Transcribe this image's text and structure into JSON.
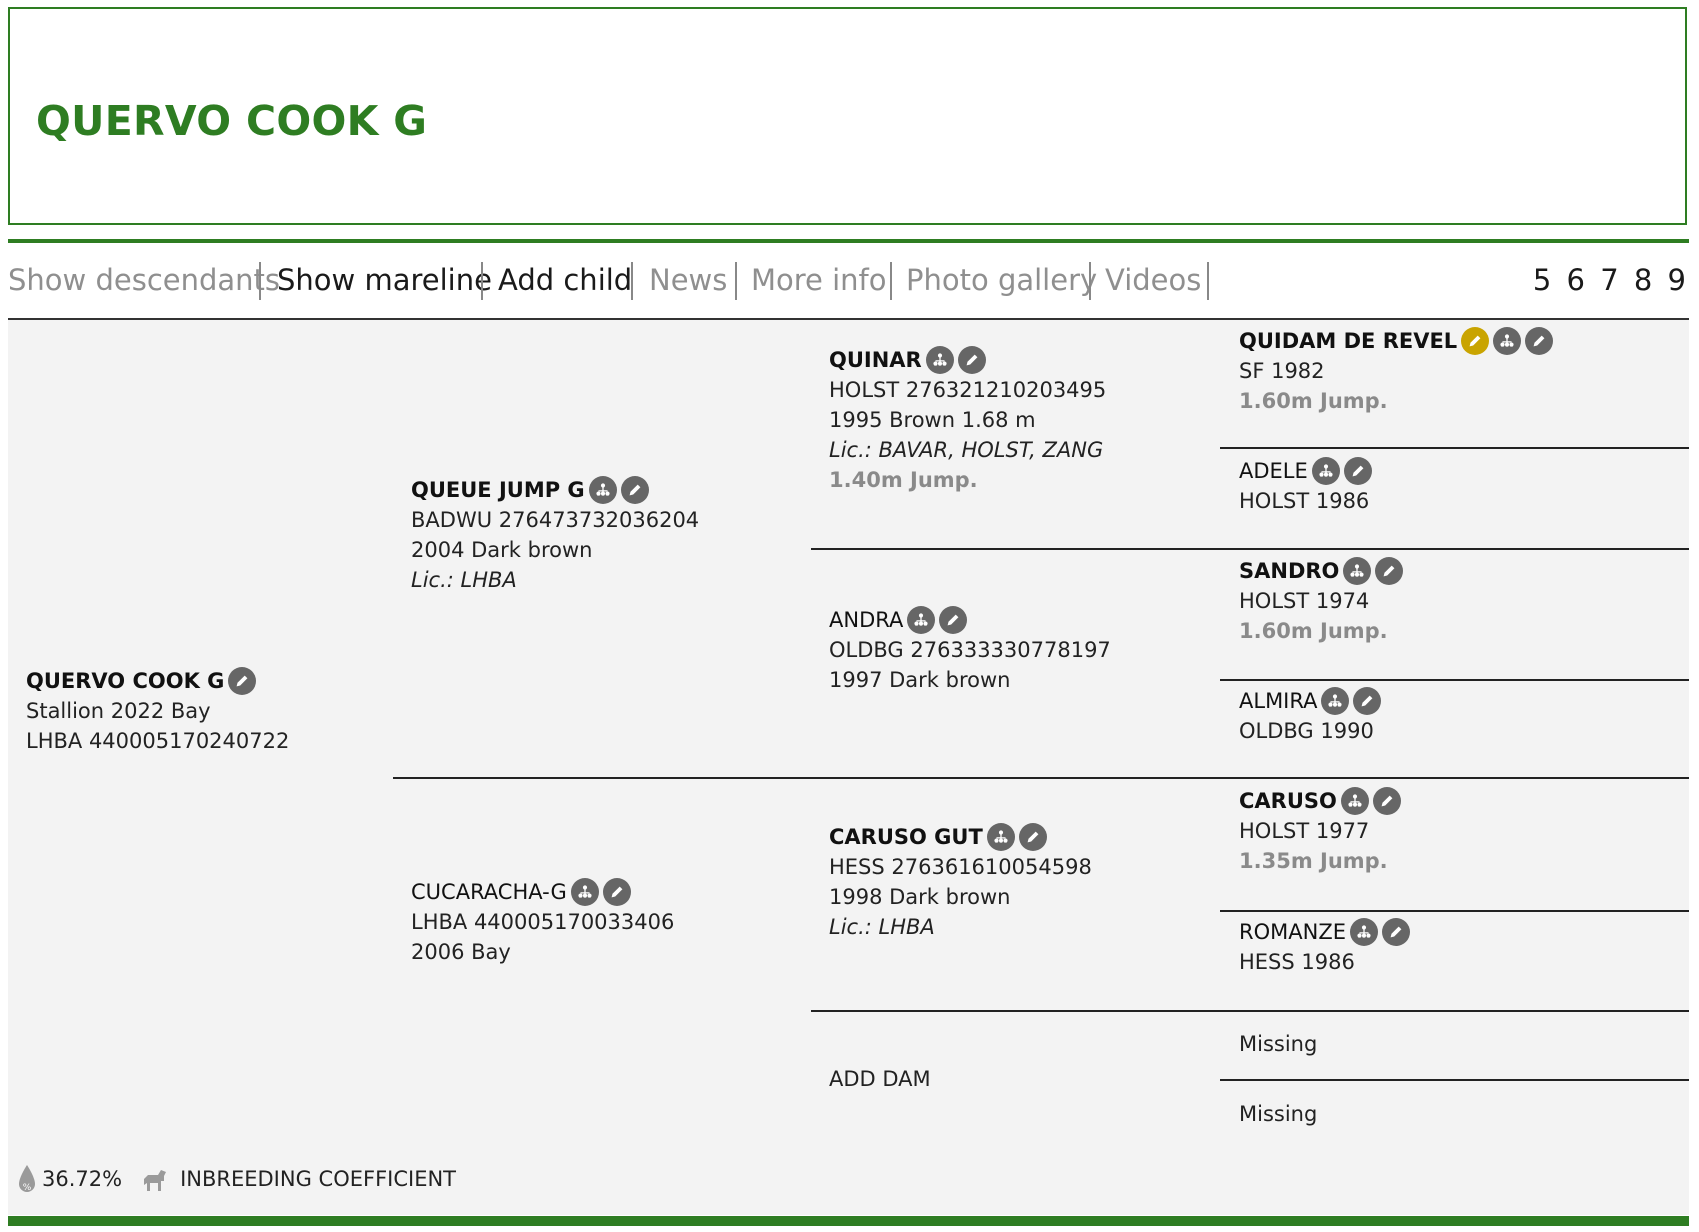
{
  "title": "QUERVO COOK G",
  "toolbar": {
    "items": [
      "Show descendants",
      "Show mareline",
      "Add child",
      "News",
      "More info",
      "Photo gallery",
      "Videos"
    ],
    "generations": "5 6 7 8 9"
  },
  "subject": {
    "name": "QUERVO COOK G",
    "line1": "Stallion 2022 Bay",
    "line2": "LHBA 440005170240722"
  },
  "sire": {
    "name": "QUEUE JUMP G",
    "line1": "BADWU 276473732036204",
    "line2": "2004 Dark brown",
    "lic": "Lic.: LHBA"
  },
  "dam": {
    "name": "CUCARACHA-G",
    "line1": "LHBA 440005170033406",
    "line2": "2006 Bay"
  },
  "sire_sire": {
    "name": "QUINAR",
    "line1": "HOLST 276321210203495",
    "line2": "1995 Brown 1.68 m",
    "lic": "Lic.: BAVAR, HOLST, ZANG",
    "perf": "1.40m Jump."
  },
  "sire_dam": {
    "name": "ANDRA",
    "line1": "OLDBG 276333330778197",
    "line2": "1997 Dark brown"
  },
  "dam_sire": {
    "name": "CARUSO GUT",
    "line1": "HESS 276361610054598",
    "line2": "1998 Dark brown",
    "lic": "Lic.: LHBA"
  },
  "dam_dam": {
    "name": "ADD DAM"
  },
  "gen3": [
    {
      "name": "QUIDAM DE REVEL",
      "line1": "SF 1982",
      "perf": "1.60m Jump."
    },
    {
      "name": "ADELE",
      "line1": "HOLST 1986"
    },
    {
      "name": "SANDRO",
      "line1": "HOLST 1974",
      "perf": "1.60m Jump."
    },
    {
      "name": "ALMIRA",
      "line1": "OLDBG 1990"
    },
    {
      "name": "CARUSO",
      "line1": "HOLST 1977",
      "perf": "1.35m Jump."
    },
    {
      "name": "ROMANZE",
      "line1": "HESS 1986"
    },
    {
      "name": "Missing"
    },
    {
      "name": "Missing"
    }
  ],
  "stats": {
    "percentage": "36.72%",
    "label": "INBREEDING COEFFICIENT"
  },
  "colors": {
    "brand_green": "#2e7d22",
    "icon_gray": "#666666",
    "icon_gold": "#c9a400",
    "panel_bg": "#f3f3f3"
  }
}
